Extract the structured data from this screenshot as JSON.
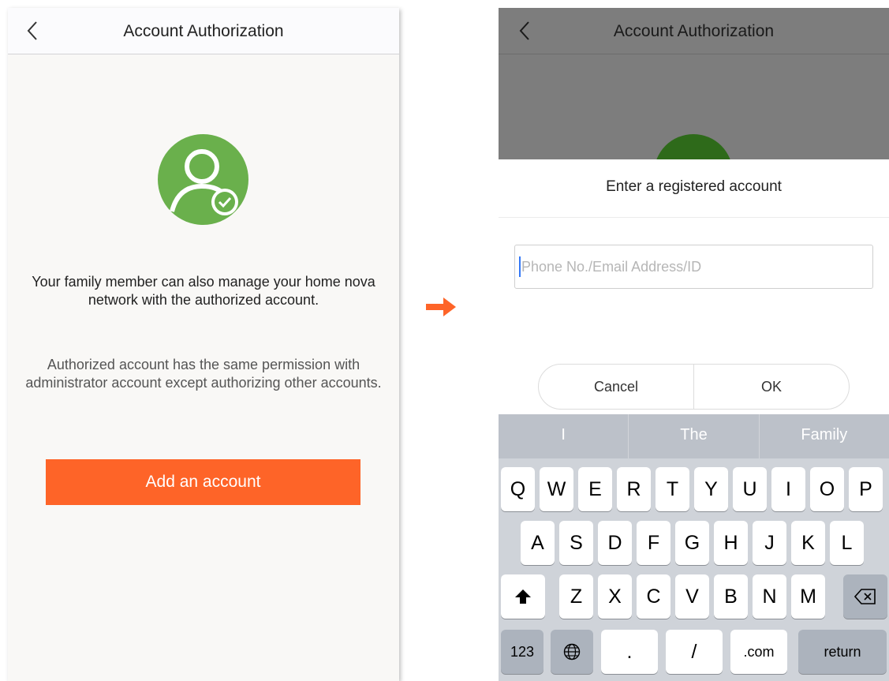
{
  "left_screen": {
    "nav_title": "Account Authorization",
    "avatar_color": "#6ab04c",
    "para1": "Your family member can also manage your home nova network with the authorized account.",
    "para2": "Authorized account has the same permission with administrator account except authorizing other accounts.",
    "add_button_label": "Add an account",
    "accent": "#fe6428"
  },
  "right_screen": {
    "nav_title": "Account Authorization",
    "dialog": {
      "title": "Enter a registered account",
      "input_placeholder": "Phone No./Email Address/ID",
      "input_value": "",
      "cancel_label": "Cancel",
      "ok_label": "OK"
    },
    "keyboard": {
      "suggestions": [
        "I",
        "The",
        "Family"
      ],
      "row1": [
        "Q",
        "W",
        "E",
        "R",
        "T",
        "Y",
        "U",
        "I",
        "O",
        "P"
      ],
      "row2": [
        "A",
        "S",
        "D",
        "F",
        "G",
        "H",
        "J",
        "K",
        "L"
      ],
      "row3": [
        "Z",
        "X",
        "C",
        "V",
        "B",
        "N",
        "M"
      ],
      "numbers_key": "123",
      "period_key": ".",
      "slash_key": "/",
      "dotcom_key": ".com",
      "return_key": "return"
    }
  }
}
